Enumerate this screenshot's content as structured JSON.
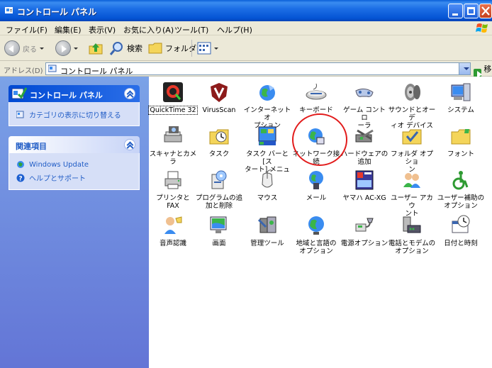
{
  "window": {
    "title": "コントロール パネル",
    "accent": "#0554d4"
  },
  "menu": [
    "ファイル(F)",
    "編集(E)",
    "表示(V)",
    "お気に入り(A)",
    "ツール(T)",
    "ヘルプ(H)"
  ],
  "toolbar": {
    "back_label": "戻る",
    "search_label": "検索",
    "folders_label": "フォルダ"
  },
  "address": {
    "label": "アドレス(D)",
    "value": "コントロール パネル",
    "go_label": "移動"
  },
  "left_pane": {
    "panel1_title": "コントロール パネル",
    "panel1_link": "カテゴリの表示に切り替える",
    "panel2_title": "関連項目",
    "panel2_links": [
      "Windows Update",
      "ヘルプとサポート"
    ]
  },
  "items": [
    {
      "label": "QuickTime 32",
      "icon": "quicktime-icon"
    },
    {
      "label": "VirusScan",
      "icon": "virusscan-icon"
    },
    {
      "label": "インターネット オ\nプション",
      "icon": "internet-options-icon"
    },
    {
      "label": "キーボード",
      "icon": "keyboard-icon"
    },
    {
      "label": "ゲーム コントロ\nーラ",
      "icon": "game-controller-icon"
    },
    {
      "label": "サウンドとオーデ\nィオ デバイス",
      "icon": "sound-icon"
    },
    {
      "label": "システム",
      "icon": "system-icon"
    },
    {
      "label": "スキャナとカメラ",
      "icon": "scanner-icon"
    },
    {
      "label": "タスク",
      "icon": "tasks-icon"
    },
    {
      "label": "タスク バーと [ス\nタート] メニュー",
      "icon": "taskbar-icon"
    },
    {
      "label": "ネットワーク接\n続",
      "icon": "network-icon"
    },
    {
      "label": "ハードウェアの\n追加",
      "icon": "add-hardware-icon"
    },
    {
      "label": "フォルダ オプショ\nン",
      "icon": "folder-options-icon"
    },
    {
      "label": "フォント",
      "icon": "fonts-icon"
    },
    {
      "label": "プリンタと FAX",
      "icon": "printer-icon"
    },
    {
      "label": "プログラムの追\n加と削除",
      "icon": "add-remove-programs-icon"
    },
    {
      "label": "マウス",
      "icon": "mouse-icon"
    },
    {
      "label": "メール",
      "icon": "mail-icon"
    },
    {
      "label": "ヤマハ AC-XG",
      "icon": "yamaha-icon"
    },
    {
      "label": "ユーザー アカウ\nント",
      "icon": "user-accounts-icon"
    },
    {
      "label": "ユーザー補助の\nオプション",
      "icon": "accessibility-icon"
    },
    {
      "label": "音声認識",
      "icon": "speech-icon"
    },
    {
      "label": "画面",
      "icon": "display-icon"
    },
    {
      "label": "管理ツール",
      "icon": "admin-tools-icon"
    },
    {
      "label": "地域と言語の\nオプション",
      "icon": "regional-icon"
    },
    {
      "label": "電源オプション",
      "icon": "power-icon"
    },
    {
      "label": "電話とモデムの\nオプション",
      "icon": "phone-modem-icon"
    },
    {
      "label": "日付と時刻",
      "icon": "date-time-icon"
    }
  ]
}
